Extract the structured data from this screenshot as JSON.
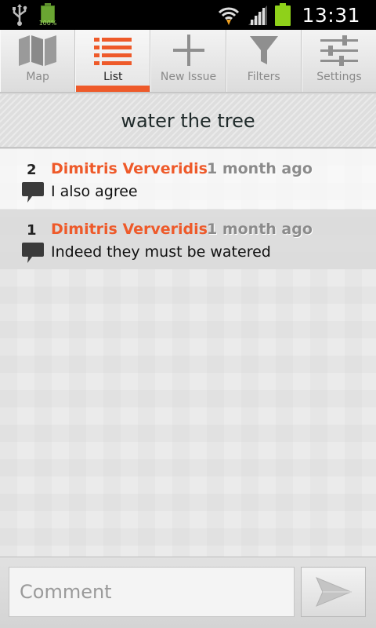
{
  "status_bar": {
    "battery_small_label": "100%",
    "time": "13:31",
    "icons": [
      "usb-icon",
      "battery-icon",
      "wifi-icon",
      "signal-icon",
      "battery-icon"
    ]
  },
  "tabs": [
    {
      "label": "Map",
      "icon": "map-icon",
      "active": false
    },
    {
      "label": "List",
      "icon": "list-icon",
      "active": true
    },
    {
      "label": "New Issue",
      "icon": "plus-icon",
      "active": false
    },
    {
      "label": "Filters",
      "icon": "filter-icon",
      "active": false
    },
    {
      "label": "Settings",
      "icon": "sliders-icon",
      "active": false
    }
  ],
  "issue_title": "water the tree",
  "comments": [
    {
      "number": "2",
      "author": "Dimitris Ververidis",
      "time": "1 month ago",
      "text": "I also agree"
    },
    {
      "number": "1",
      "author": "Dimitris Ververidis",
      "time": "1 month ago",
      "text": "Indeed they must be watered"
    }
  ],
  "composer": {
    "placeholder": "Comment",
    "value": "",
    "send_icon": "send-icon"
  },
  "colors": {
    "accent": "#ee5a2a",
    "timestamp": "#8b8b8b",
    "battery": "#8fd11a"
  }
}
